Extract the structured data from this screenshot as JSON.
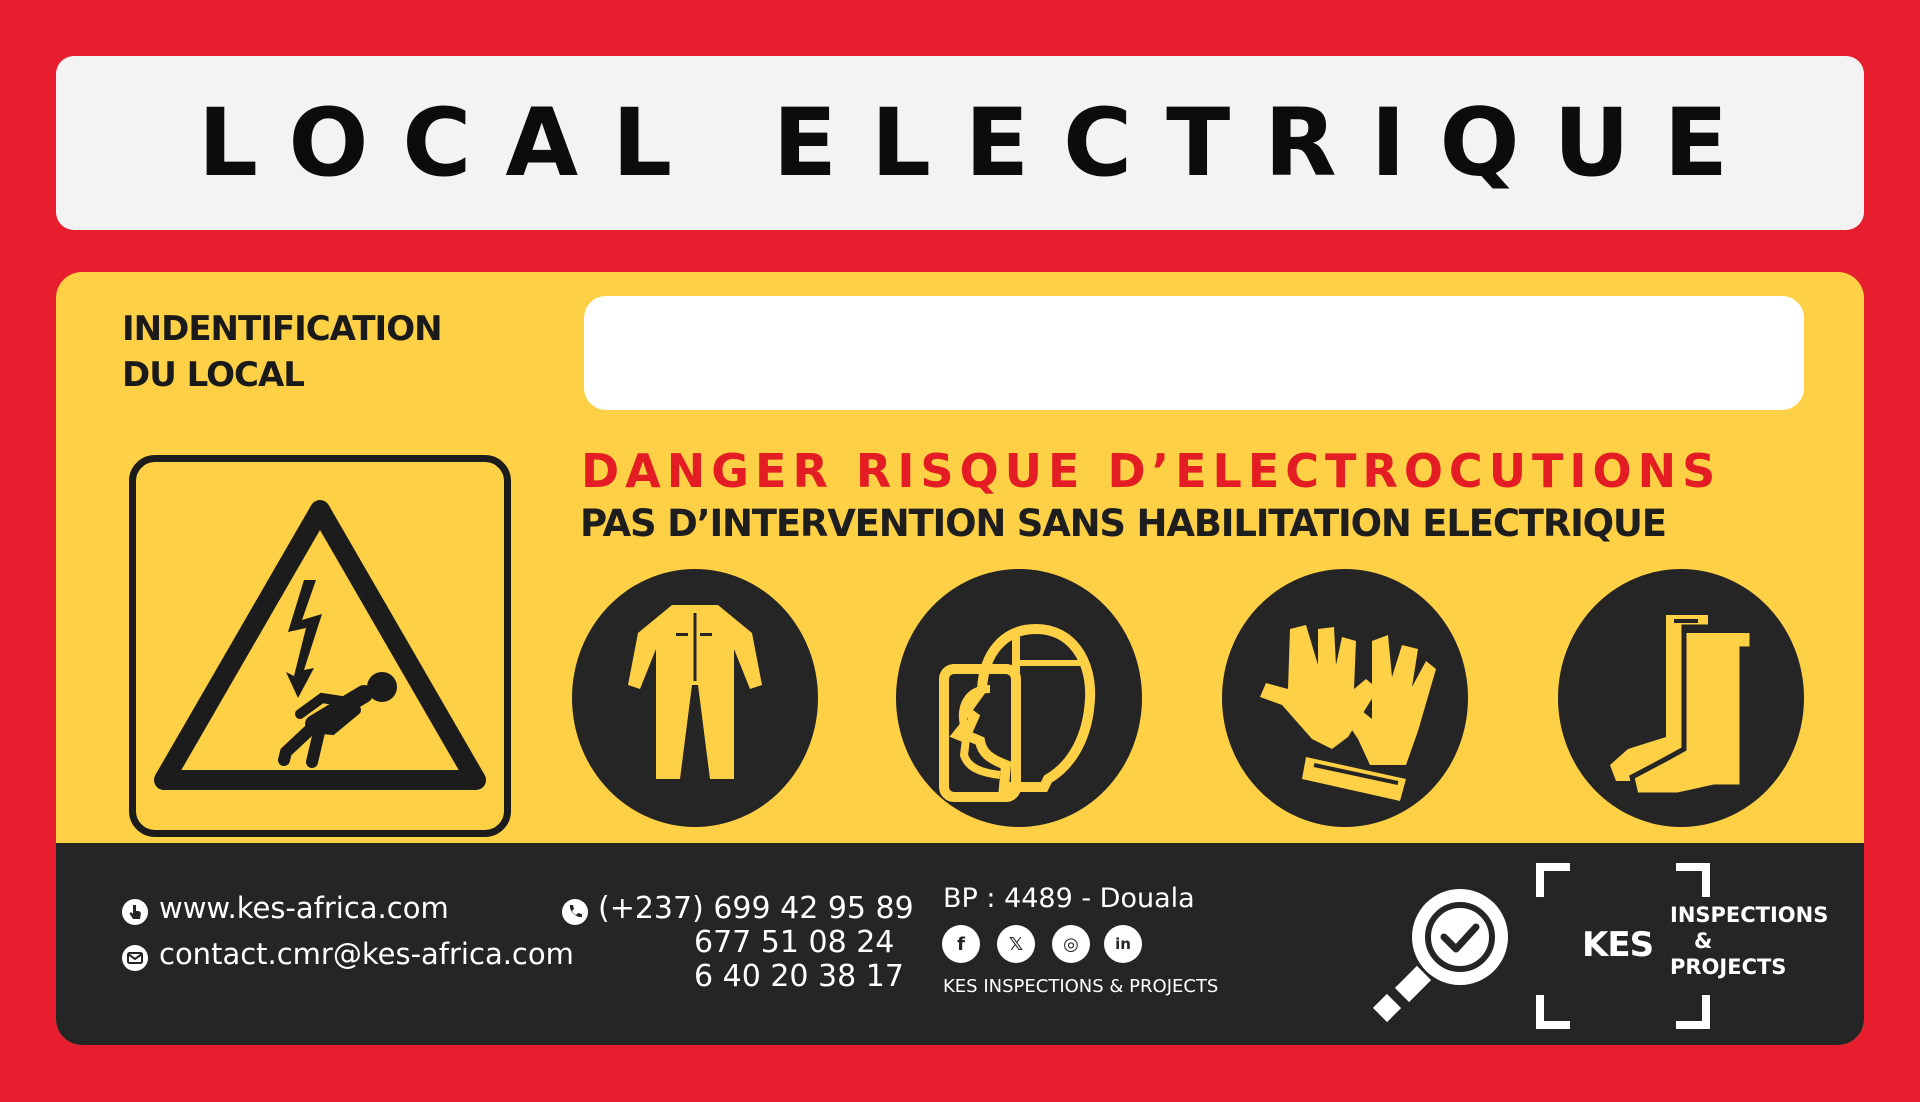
{
  "title": "LOCAL ELECTRIQUE",
  "identification": {
    "label_line1": "INDENTIFICATION",
    "label_line2": "DU LOCAL",
    "value": ""
  },
  "warnings": {
    "danger": "DANGER RISQUE D’ELECTROCUTIONS",
    "habilitation": "PAS D’INTERVENTION SANS HABILITATION ELECTRIQUE"
  },
  "icons": {
    "warning": "electric-shock-warning-icon",
    "ppe": [
      "coverall-icon",
      "face-shield-icon",
      "gloves-icon",
      "boots-icon"
    ]
  },
  "footer": {
    "website": "www.kes-africa.com",
    "email": "contact.cmr@kes-africa.com",
    "phones": [
      "(+237) 699 42 95 89",
      "677 51 08 24",
      "6 40 20 38 17"
    ],
    "address": "BP : 4489 - Douala",
    "socials": [
      "f",
      "𝕏",
      "◎",
      "in"
    ],
    "company_name": "KES INSPECTIONS & PROJECTS",
    "logo": {
      "kes": "KES",
      "line1": "INSPECTIONS",
      "line2": "&",
      "line3": "PROJECTS"
    }
  },
  "colors": {
    "red": "#E61E2E",
    "yellow": "#FDD045",
    "dark": "#252525",
    "light": "#F3F3F3"
  }
}
